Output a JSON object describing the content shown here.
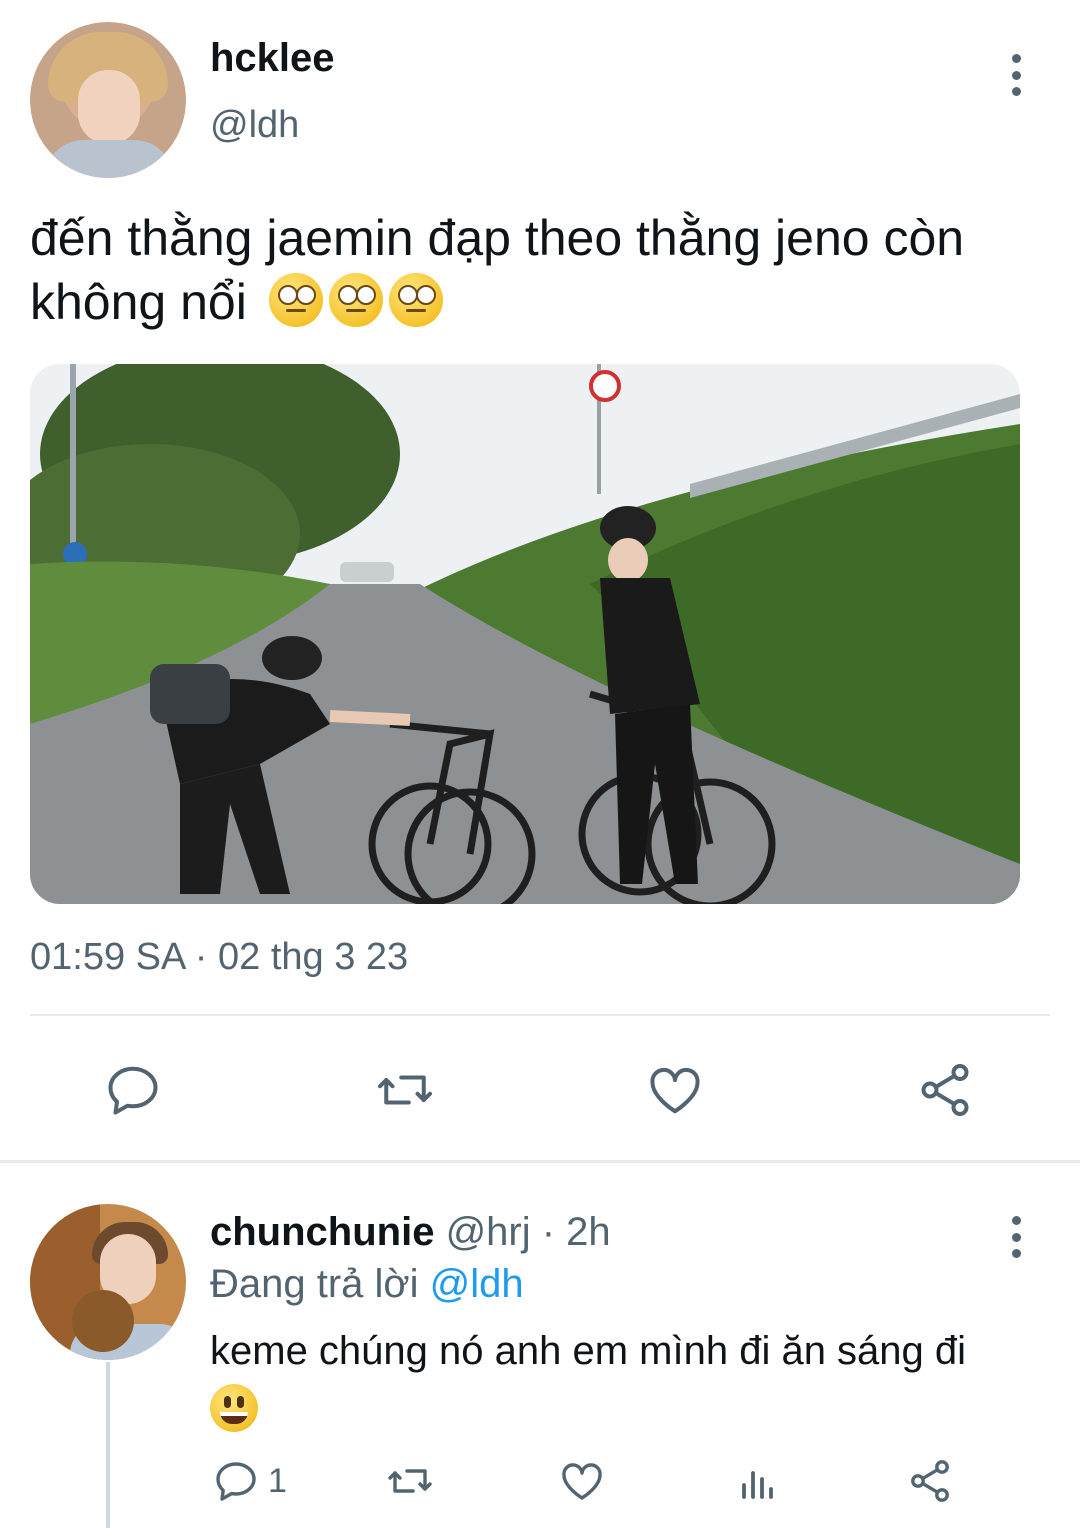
{
  "tweet": {
    "display_name": "hcklee",
    "handle": "@ldh",
    "text": "đến thằng jaemin đạp theo thằng jeno còn không nổi",
    "emoji": [
      "face-with-rolling-eyes",
      "face-with-rolling-eyes",
      "face-with-rolling-eyes"
    ],
    "timestamp": "01:59 SA · 02 thg 3 23"
  },
  "reply": {
    "display_name": "chunchunie",
    "meta": "@hrj · 2h",
    "replying_prefix": "Đang trả lời",
    "replying_to": "@ldh",
    "text": "keme chúng nó anh em mình đi ăn sáng đi",
    "emoji": "grinning-face",
    "reply_count": "1"
  },
  "colors": {
    "primary_text": "#0f1419",
    "secondary_text": "#536471",
    "accent": "#1d9bf0",
    "divider": "#e6e9ec"
  },
  "icons": {
    "main_actions": [
      "reply-icon",
      "retweet-icon",
      "like-icon",
      "share-icon"
    ],
    "reply_actions": [
      "reply-icon",
      "retweet-icon",
      "like-icon",
      "analytics-icon",
      "share-icon"
    ]
  }
}
